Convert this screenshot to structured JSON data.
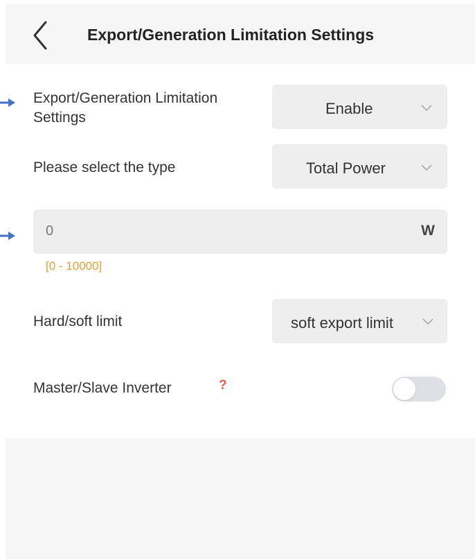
{
  "header": {
    "title": "Export/Generation Limitation Settings"
  },
  "rows": {
    "limitation": {
      "label": "Export/Generation Limitation\nSettings",
      "value": "Enable"
    },
    "type": {
      "label": "Please select the type",
      "value": "Total Power"
    },
    "power": {
      "value": "0",
      "unit": "W",
      "range": "[0 - 10000]"
    },
    "hard_soft": {
      "label": "Hard/soft limit",
      "value": "soft export limit"
    },
    "master_slave": {
      "label": "Master/Slave Inverter",
      "help": "?",
      "enabled": false
    }
  },
  "icons": {
    "back": "chevron-left-icon",
    "dropdown": "chevron-down-icon",
    "pointer": "arrow-right-icon"
  },
  "colors": {
    "accent_range": "#e3a335",
    "help": "#e85a4f",
    "pointer_arrow": "#4472c4",
    "field_bg": "#eeeeee"
  }
}
